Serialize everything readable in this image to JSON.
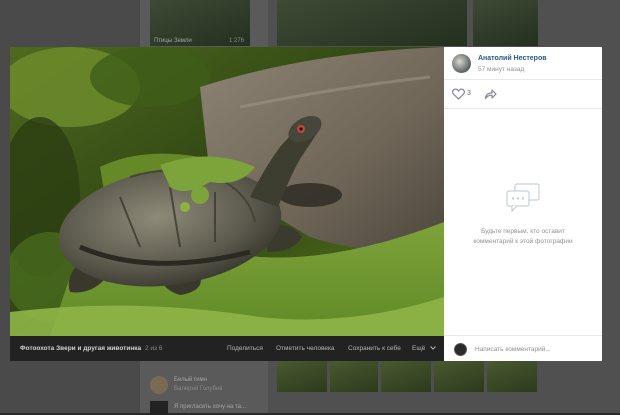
{
  "background": {
    "album_caption": "Птицы Земли",
    "album_count": "1 276",
    "feed_item_1": "Белый гимн",
    "feed_item_1_sub": "Валерий Голубев",
    "feed_item_2": "Я пригласить хочу на та..."
  },
  "photo": {
    "album_title": "Фотоохота Звери и другая животинка",
    "position": "2 из 6",
    "actions": [
      {
        "label": "Поделиться"
      },
      {
        "label": "Отметить человека"
      },
      {
        "label": "Сохранить к себе"
      },
      {
        "label": "Ещё"
      }
    ]
  },
  "sidebar": {
    "author_name": "Анатолий Нестеров",
    "post_time": "57 минут назад",
    "likes_count": "3",
    "empty_line_1": "Будьте первым, кто оставит",
    "empty_line_2": "комментарий к этой фотографии",
    "comment_placeholder": "Написать комментарий..."
  },
  "colors": {
    "link": "#2a5885",
    "panel_bg": "#ffffff",
    "bar_bg": "#222222"
  },
  "icons": [
    "heart-icon",
    "share-arrow-icon",
    "comments-empty-icon",
    "chevron-down-icon"
  ]
}
